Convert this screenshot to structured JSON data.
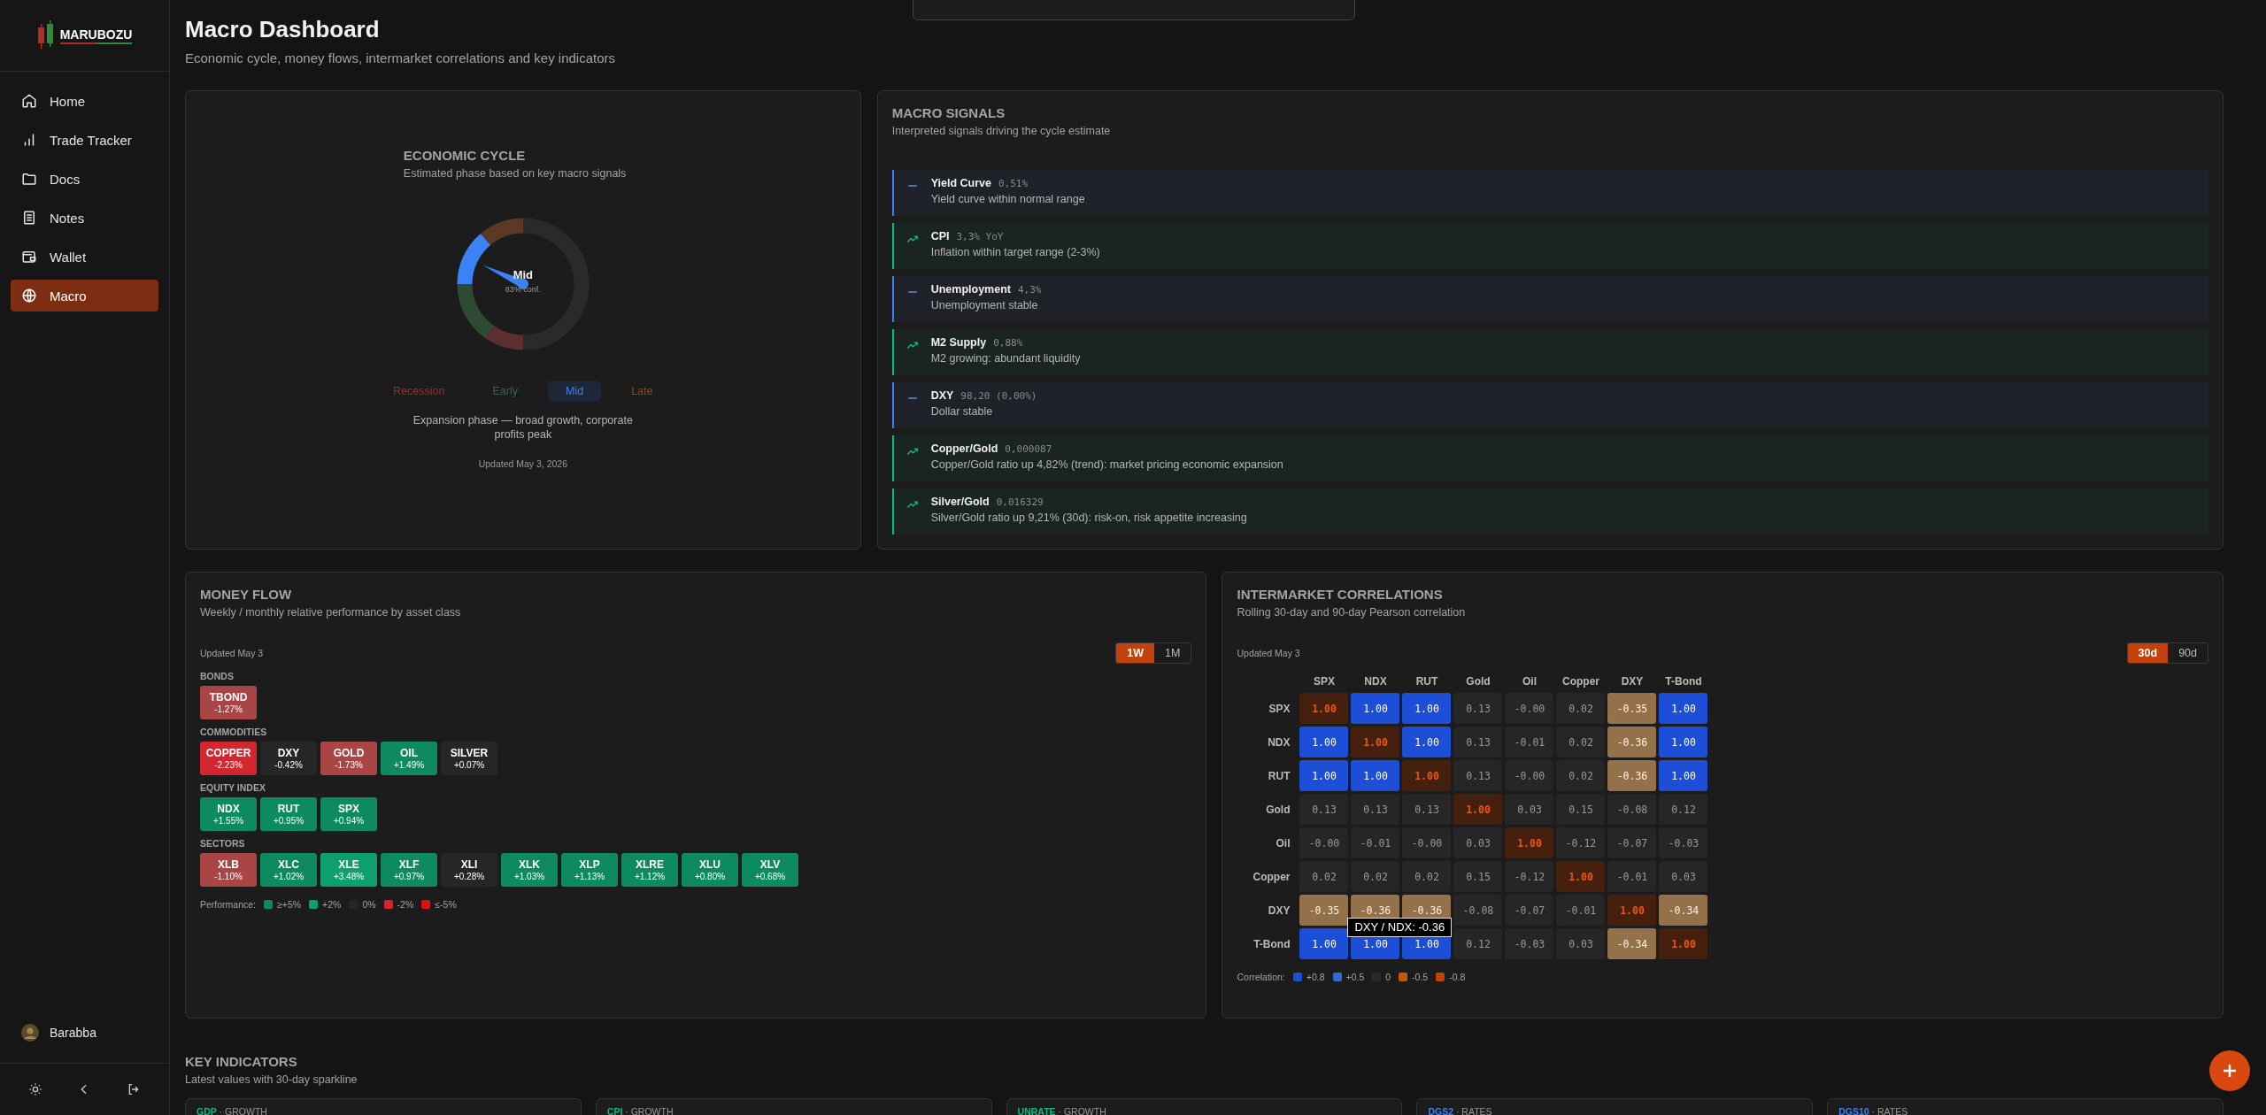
{
  "sidebar": {
    "brand": "MARUBOZU",
    "items": [
      {
        "label": "Home",
        "selected": false
      },
      {
        "label": "Trade Tracker",
        "selected": false
      },
      {
        "label": "Docs",
        "selected": false
      },
      {
        "label": "Notes",
        "selected": false
      },
      {
        "label": "Wallet",
        "selected": false
      },
      {
        "label": "Macro",
        "selected": true
      }
    ],
    "user": "Barabba"
  },
  "header": {
    "title": "Macro Dashboard",
    "subtitle": "Economic cycle, money flows, intermarket correlations and key indicators"
  },
  "economic_cycle": {
    "title": "ECONOMIC CYCLE",
    "subtitle": "Estimated phase based on key macro signals",
    "gauge_label": "Mid",
    "confidence": "83% conf.",
    "phases": [
      {
        "label": "Recession",
        "selected": false,
        "color": "#8b3434"
      },
      {
        "label": "Early",
        "selected": false,
        "color": "#2f6b3c"
      },
      {
        "label": "Mid",
        "selected": true,
        "color": "#3b82f6"
      },
      {
        "label": "Late",
        "selected": false,
        "color": "#8a4a1e"
      }
    ],
    "description": "Expansion phase — broad growth, corporate profits peak",
    "updated": "Updated May 3, 2026"
  },
  "macro_signals": {
    "title": "MACRO SIGNALS",
    "subtitle": "Interpreted signals driving the cycle estimate",
    "signals": [
      {
        "kind": "flat",
        "name": "Yield Curve",
        "value": "0,51%",
        "text": "Yield curve within normal range"
      },
      {
        "kind": "up",
        "name": "CPI",
        "value": "3,3% YoY",
        "text": "Inflation within target range (2-3%)"
      },
      {
        "kind": "flat",
        "name": "Unemployment",
        "value": "4,3%",
        "text": "Unemployment stable"
      },
      {
        "kind": "up",
        "name": "M2 Supply",
        "value": "0,88%",
        "text": "M2 growing: abundant liquidity"
      },
      {
        "kind": "flat",
        "name": "DXY",
        "value": "98,20 (0,00%)",
        "text": "Dollar stable"
      },
      {
        "kind": "up",
        "name": "Copper/Gold",
        "value": "0,000087",
        "text": "Copper/Gold ratio up 4,82% (trend): market pricing economic expansion"
      },
      {
        "kind": "up",
        "name": "Silver/Gold",
        "value": "0,016329",
        "text": "Silver/Gold ratio up 9,21% (30d): risk-on, risk appetite increasing"
      }
    ]
  },
  "money_flow": {
    "title": "MONEY FLOW",
    "subtitle": "Weekly / monthly relative performance by asset class",
    "updated": "Updated May 3",
    "periods": [
      {
        "label": "1W",
        "selected": true
      },
      {
        "label": "1M",
        "selected": false
      }
    ],
    "groups": [
      {
        "label": "BONDS",
        "tiles": [
          {
            "symbol": "TBOND",
            "change": "-1.27%",
            "color": "#a94545"
          }
        ]
      },
      {
        "label": "COMMODITIES",
        "tiles": [
          {
            "symbol": "COPPER",
            "change": "-2.23%",
            "color": "#d4262e"
          },
          {
            "symbol": "DXY",
            "change": "-0.42%",
            "color": "#262626"
          },
          {
            "symbol": "GOLD",
            "change": "-1.73%",
            "color": "#a94545"
          },
          {
            "symbol": "OIL",
            "change": "+1.49%",
            "color": "#0d8a5e"
          },
          {
            "symbol": "SILVER",
            "change": "+0.07%",
            "color": "#262626"
          }
        ]
      },
      {
        "label": "EQUITY INDEX",
        "tiles": [
          {
            "symbol": "NDX",
            "change": "+1.55%",
            "color": "#0d8a5e"
          },
          {
            "symbol": "RUT",
            "change": "+0.95%",
            "color": "#0d8a5e"
          },
          {
            "symbol": "SPX",
            "change": "+0.94%",
            "color": "#0d8a5e"
          }
        ]
      },
      {
        "label": "SECTORS",
        "tiles": [
          {
            "symbol": "XLB",
            "change": "-1.10%",
            "color": "#a94545"
          },
          {
            "symbol": "XLC",
            "change": "+1.02%",
            "color": "#0d8a5e"
          },
          {
            "symbol": "XLE",
            "change": "+3.48%",
            "color": "#0ea06c"
          },
          {
            "symbol": "XLF",
            "change": "+0.97%",
            "color": "#0d8a5e"
          },
          {
            "symbol": "XLI",
            "change": "+0.28%",
            "color": "#262626"
          },
          {
            "symbol": "XLK",
            "change": "+1.03%",
            "color": "#0d8a5e"
          },
          {
            "symbol": "XLP",
            "change": "+1.13%",
            "color": "#0d8a5e"
          },
          {
            "symbol": "XLRE",
            "change": "+1.12%",
            "color": "#0d8a5e"
          },
          {
            "symbol": "XLU",
            "change": "+0.80%",
            "color": "#0d8a5e"
          },
          {
            "symbol": "XLV",
            "change": "+0.68%",
            "color": "#0d8a5e"
          }
        ]
      }
    ],
    "legend_label": "Performance:",
    "legend": [
      {
        "label": "≥+5%",
        "color": "#0d8a5e"
      },
      {
        "label": "+2%",
        "color": "#0ea06c"
      },
      {
        "label": "0%",
        "color": "#262626"
      },
      {
        "label": "-2%",
        "color": "#d4262e"
      },
      {
        "label": "≤-5%",
        "color": "#e01010"
      }
    ]
  },
  "correlations": {
    "title": "INTERMARKET CORRELATIONS",
    "subtitle": "Rolling 30-day and 90-day Pearson correlation",
    "updated": "Updated May 3",
    "periods": [
      {
        "label": "30d",
        "selected": true
      },
      {
        "label": "90d",
        "selected": false
      }
    ],
    "columns": [
      "SPX",
      "NDX",
      "RUT",
      "Gold",
      "Oil",
      "Copper",
      "DXY",
      "T-Bond"
    ],
    "rows": [
      {
        "label": "SPX",
        "cells": [
          {
            "value": "1.00",
            "kind": "self"
          },
          {
            "value": "1.00",
            "kind": "pos"
          },
          {
            "value": "1.00",
            "kind": "pos"
          },
          {
            "value": "0.13",
            "kind": "flat"
          },
          {
            "value": "-0.00",
            "kind": "flat"
          },
          {
            "value": "0.02",
            "kind": "flat"
          },
          {
            "value": "-0.35",
            "kind": "neg"
          },
          {
            "value": "1.00",
            "kind": "pos"
          }
        ]
      },
      {
        "label": "NDX",
        "cells": [
          {
            "value": "1.00",
            "kind": "pos"
          },
          {
            "value": "1.00",
            "kind": "self"
          },
          {
            "value": "1.00",
            "kind": "pos"
          },
          {
            "value": "0.13",
            "kind": "flat"
          },
          {
            "value": "-0.01",
            "kind": "flat"
          },
          {
            "value": "0.02",
            "kind": "flat"
          },
          {
            "value": "-0.36",
            "kind": "neg"
          },
          {
            "value": "1.00",
            "kind": "pos"
          }
        ]
      },
      {
        "label": "RUT",
        "cells": [
          {
            "value": "1.00",
            "kind": "pos"
          },
          {
            "value": "1.00",
            "kind": "pos"
          },
          {
            "value": "1.00",
            "kind": "self"
          },
          {
            "value": "0.13",
            "kind": "flat"
          },
          {
            "value": "-0.00",
            "kind": "flat"
          },
          {
            "value": "0.02",
            "kind": "flat"
          },
          {
            "value": "-0.36",
            "kind": "neg"
          },
          {
            "value": "1.00",
            "kind": "pos"
          }
        ]
      },
      {
        "label": "Gold",
        "cells": [
          {
            "value": "0.13",
            "kind": "flat"
          },
          {
            "value": "0.13",
            "kind": "flat"
          },
          {
            "value": "0.13",
            "kind": "flat"
          },
          {
            "value": "1.00",
            "kind": "self"
          },
          {
            "value": "0.03",
            "kind": "flat"
          },
          {
            "value": "0.15",
            "kind": "flat"
          },
          {
            "value": "-0.08",
            "kind": "flat"
          },
          {
            "value": "0.12",
            "kind": "flat"
          }
        ]
      },
      {
        "label": "Oil",
        "cells": [
          {
            "value": "-0.00",
            "kind": "flat"
          },
          {
            "value": "-0.01",
            "kind": "flat"
          },
          {
            "value": "-0.00",
            "kind": "flat"
          },
          {
            "value": "0.03",
            "kind": "flat"
          },
          {
            "value": "1.00",
            "kind": "self"
          },
          {
            "value": "-0.12",
            "kind": "flat"
          },
          {
            "value": "-0.07",
            "kind": "flat"
          },
          {
            "value": "-0.03",
            "kind": "flat"
          }
        ]
      },
      {
        "label": "Copper",
        "cells": [
          {
            "value": "0.02",
            "kind": "flat"
          },
          {
            "value": "0.02",
            "kind": "flat"
          },
          {
            "value": "0.02",
            "kind": "flat"
          },
          {
            "value": "0.15",
            "kind": "flat"
          },
          {
            "value": "-0.12",
            "kind": "flat"
          },
          {
            "value": "1.00",
            "kind": "self"
          },
          {
            "value": "-0.01",
            "kind": "flat"
          },
          {
            "value": "0.03",
            "kind": "flat"
          }
        ]
      },
      {
        "label": "DXY",
        "cells": [
          {
            "value": "-0.35",
            "kind": "neg"
          },
          {
            "value": "-0.36",
            "kind": "neg"
          },
          {
            "value": "-0.36",
            "kind": "neg"
          },
          {
            "value": "-0.08",
            "kind": "flat"
          },
          {
            "value": "-0.07",
            "kind": "flat"
          },
          {
            "value": "-0.01",
            "kind": "flat"
          },
          {
            "value": "1.00",
            "kind": "self"
          },
          {
            "value": "-0.34",
            "kind": "neg"
          }
        ]
      },
      {
        "label": "T-Bond",
        "cells": [
          {
            "value": "1.00",
            "kind": "pos"
          },
          {
            "value": "1.00",
            "kind": "pos"
          },
          {
            "value": "1.00",
            "kind": "pos"
          },
          {
            "value": "0.12",
            "kind": "flat"
          },
          {
            "value": "-0.03",
            "kind": "flat"
          },
          {
            "value": "0.03",
            "kind": "flat"
          },
          {
            "value": "-0.34",
            "kind": "neg"
          },
          {
            "value": "1.00",
            "kind": "self"
          }
        ]
      }
    ],
    "tooltip": "DXY / NDX: -0.36",
    "legend_label": "Correlation:",
    "legend": [
      {
        "label": "+0.8",
        "color": "#1d4ed8"
      },
      {
        "label": "+0.5",
        "color": "#2f6bd0"
      },
      {
        "label": "0",
        "color": "#2a2a2a"
      },
      {
        "label": "-0.5",
        "color": "#c2570f"
      },
      {
        "label": "-0.8",
        "color": "#c2410c"
      }
    ]
  },
  "key_indicators": {
    "title": "KEY INDICATORS",
    "subtitle": "Latest values with 30-day sparkline",
    "cards": [
      {
        "series": "GDP",
        "category": "· GROWTH",
        "kind": "growth"
      },
      {
        "series": "CPI",
        "category": "· GROWTH",
        "kind": "growth"
      },
      {
        "series": "UNRATE",
        "category": "· GROWTH",
        "kind": "growth"
      },
      {
        "series": "DGS2",
        "category": "· RATES",
        "kind": "rates"
      },
      {
        "series": "DGS10",
        "category": "· RATES",
        "kind": "rates"
      }
    ]
  }
}
